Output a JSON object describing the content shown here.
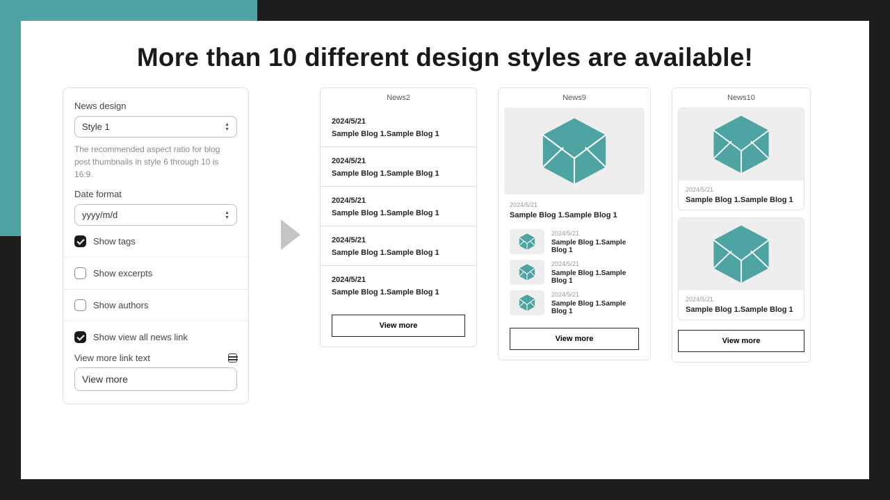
{
  "heading": "More than 10 different design styles are available!",
  "settings": {
    "news_design_label": "News design",
    "news_design_value": "Style 1",
    "news_design_help": "The recommended aspect ratio for blog post thumbnails in style 6 through 10 is 16:9.",
    "date_format_label": "Date format",
    "date_format_value": "yyyy/m/d",
    "show_tags_label": "Show tags",
    "show_excerpts_label": "Show excerpts",
    "show_authors_label": "Show authors",
    "show_view_all_label": "Show view all news link",
    "view_more_label": "View more link text",
    "view_more_value": "View more"
  },
  "previews": {
    "news2": {
      "title": "News2",
      "items": [
        {
          "date": "2024/5/21",
          "title": "Sample Blog 1.Sample Blog 1"
        },
        {
          "date": "2024/5/21",
          "title": "Sample Blog 1.Sample Blog 1"
        },
        {
          "date": "2024/5/21",
          "title": "Sample Blog 1.Sample Blog 1"
        },
        {
          "date": "2024/5/21",
          "title": "Sample Blog 1.Sample Blog 1"
        },
        {
          "date": "2024/5/21",
          "title": "Sample Blog 1.Sample Blog 1"
        }
      ],
      "button": "View more"
    },
    "news9": {
      "title": "News9",
      "main": {
        "date": "2024/5/21",
        "title": "Sample Blog 1.Sample Blog 1"
      },
      "rows": [
        {
          "date": "2024/5/21",
          "title": "Sample Blog 1.Sample Blog 1"
        },
        {
          "date": "2024/5/21",
          "title": "Sample Blog 1.Sample Blog 1"
        },
        {
          "date": "2024/5/21",
          "title": "Sample Blog 1.Sample Blog 1"
        }
      ],
      "button": "View more"
    },
    "news10": {
      "title": "News10",
      "cards": [
        {
          "date": "2024/5/21",
          "title": "Sample Blog 1.Sample Blog 1"
        },
        {
          "date": "2024/5/21",
          "title": "Sample Blog 1.Sample Blog 1"
        }
      ],
      "button": "View more"
    }
  }
}
